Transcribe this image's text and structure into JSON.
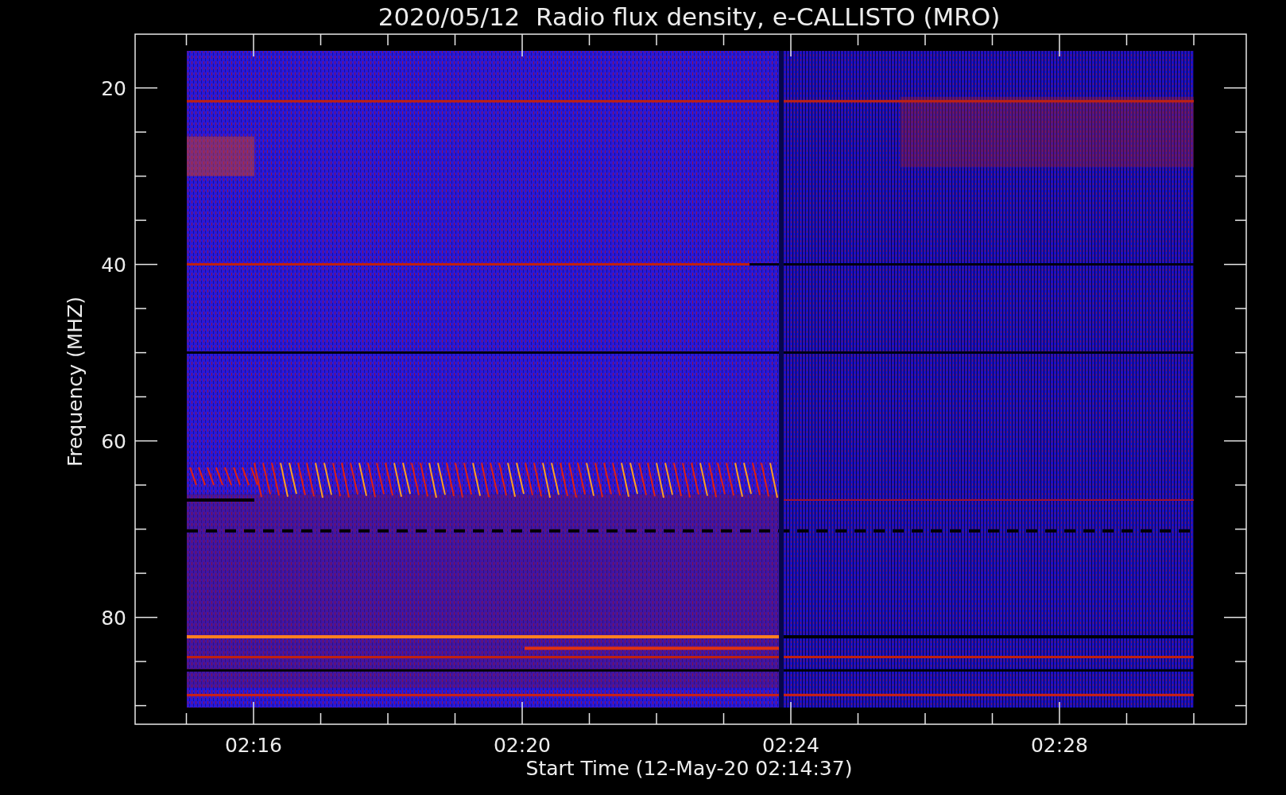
{
  "title": "2020/05/12  Radio flux density, e-CALLISTO (MRO)",
  "y_axis": {
    "label": "Frequency (MHZ)",
    "ticks": [
      "20",
      "40",
      "60",
      "80"
    ]
  },
  "x_axis": {
    "label": "Start Time (12-May-20 02:14:37)",
    "ticks": [
      "02:16",
      "02:20",
      "02:24",
      "02:28"
    ]
  }
}
